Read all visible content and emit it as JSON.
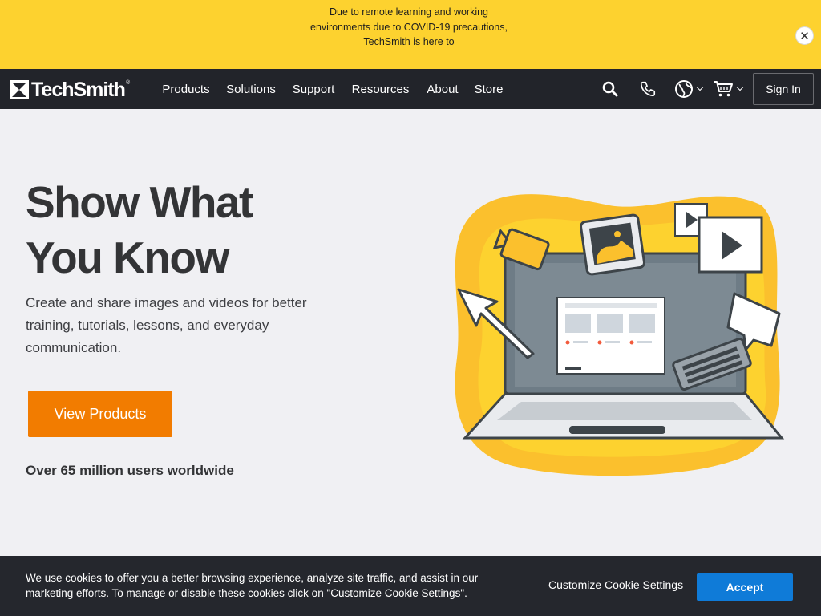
{
  "banner": {
    "text": "Due to remote learning and working environments due to COVID-19 precautions, TechSmith is here to",
    "close_symbol": "✕"
  },
  "nav": {
    "logo_text": "TechSmith",
    "logo_reg": "®",
    "items": [
      {
        "label": "Products"
      },
      {
        "label": "Solutions"
      },
      {
        "label": "Support"
      },
      {
        "label": "Resources"
      },
      {
        "label": "About"
      },
      {
        "label": "Store"
      }
    ],
    "icons": [
      "search-icon",
      "phone-icon",
      "globe-icon",
      "cart-icon"
    ],
    "signin_label": "Sign In"
  },
  "hero": {
    "title_line1": "Show What",
    "title_line2": "You Know",
    "subtitle": "Create and share images and videos for better training, tutorials, lessons, and everyday communication.",
    "button_label": "View Products",
    "users_text": "Over 65 million users worldwide"
  },
  "cookie": {
    "text": "We use cookies to offer you a better browsing experience, analyze site traffic, and assist in our marketing efforts. To manage or disable these cookies click on \"Customize Cookie Settings\".",
    "customize_label": "Customize Cookie Settings",
    "accept_label": "Accept"
  },
  "colors": {
    "banner": "#fdd22f",
    "nav": "#22242a",
    "primary_button": "#f27c00",
    "accept_button": "#0f7bd8"
  }
}
